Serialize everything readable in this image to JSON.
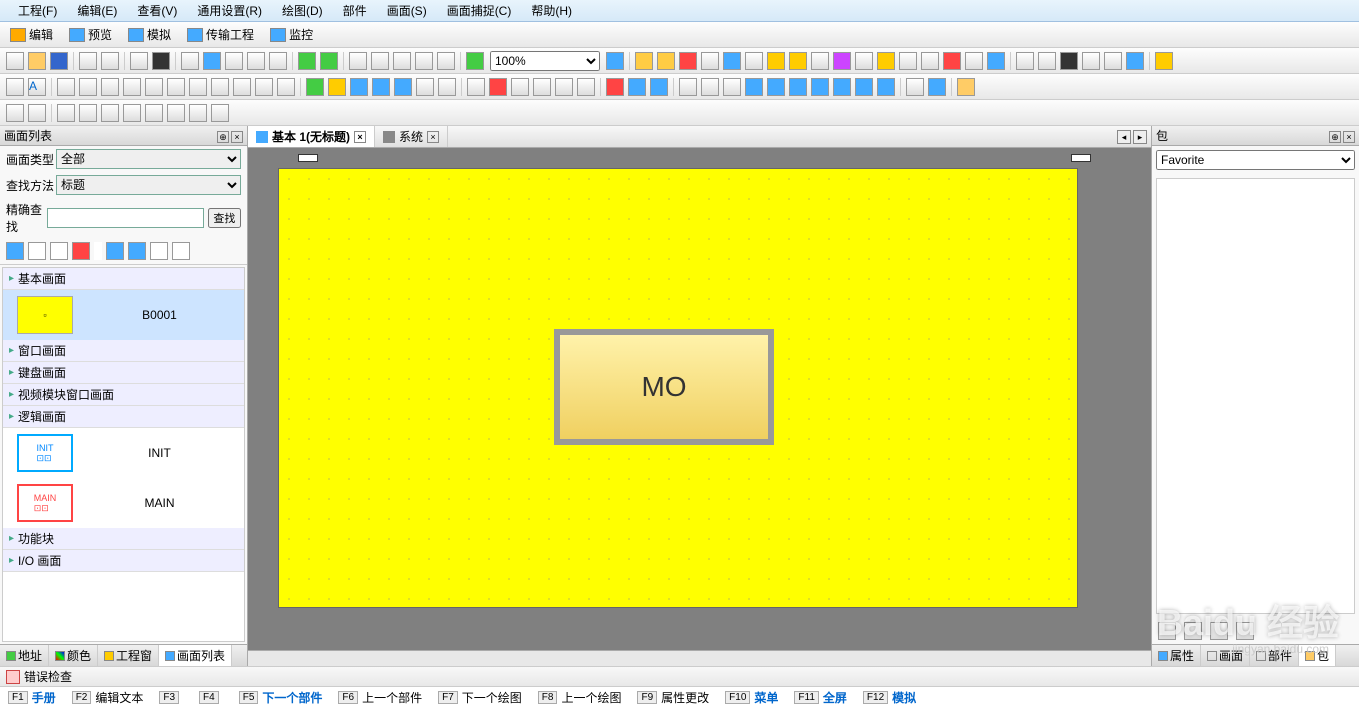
{
  "menu": {
    "project": "工程(F)",
    "edit": "编辑(E)",
    "view": "查看(V)",
    "common": "通用设置(R)",
    "draw": "绘图(D)",
    "parts": "部件",
    "screen": "画面(S)",
    "capture": "画面捕捉(C)",
    "help": "帮助(H)"
  },
  "modebar": {
    "edit": "编辑",
    "preview": "预览",
    "simulate": "模拟",
    "transfer": "传输工程",
    "monitor": "监控"
  },
  "zoom": "100%",
  "screenlist": {
    "title": "画面列表",
    "type_label": "画面类型",
    "type_value": "全部",
    "search_label": "查找方法",
    "search_value": "标题",
    "exact_label": "精确查找",
    "search_btn": "查找",
    "cats": {
      "basic": "基本画面",
      "window": "窗口画面",
      "keyboard": "键盘画面",
      "video": "视频模块窗口画面",
      "logic": "逻辑画面",
      "func": "功能块",
      "io": "I/O 画面"
    },
    "items": {
      "b0001": "B0001",
      "init": "INIT",
      "main": "MAIN"
    }
  },
  "lefttabs": {
    "addr": "地址",
    "color": "颜色",
    "workwin": "工程窗",
    "screenlist": "画面列表"
  },
  "doctabs": {
    "basic1": "基本 1(无标题)",
    "system": "系统"
  },
  "canvas": {
    "mo_label": "MO"
  },
  "rightpanel": {
    "title": "包",
    "fav": "Favorite"
  },
  "righttabs": {
    "prop": "属性",
    "screen": "画面",
    "parts": "部件",
    "pack": "包"
  },
  "error": "错误检查",
  "fkeys": {
    "f1": "手册",
    "f2": "编辑文本",
    "f3": "",
    "f4": "",
    "f5": "下一个部件",
    "f6": "上一个部件",
    "f7": "下一个绘图",
    "f8": "上一个绘图",
    "f9": "属性更改",
    "f10": "菜单",
    "f11": "全屏",
    "f12": "模拟"
  },
  "watermark": "Baidu 经验",
  "watermark_sub": "jingyan.baidu.com"
}
